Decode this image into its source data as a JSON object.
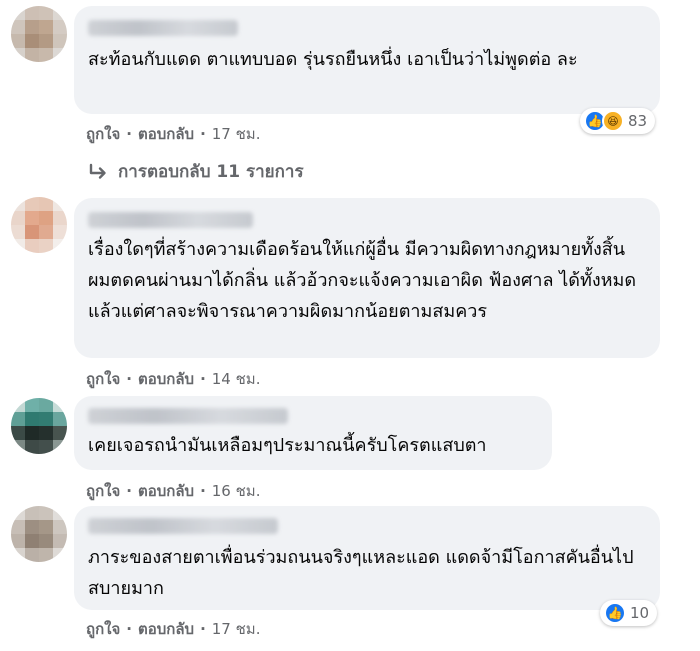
{
  "comments": [
    {
      "text": "สะท้อนกับแดด ตาแทบบอด รุ่นรถยืนหนึ่ง เอาเป็นว่าไม่พูดต่อ ละ",
      "like_label": "ถูกใจ",
      "reply_label": "ตอบกลับ",
      "time": "17 ชม.",
      "reaction_count": "83",
      "reactions": [
        "like-icon",
        "haha-icon"
      ]
    },
    {
      "text": "เรื่องใดๆที่สร้างความเดือดร้อนให้แก่ผู้อื่น มีความผิดทางกฎหมายทั้งสิ้น ผมตดคนผ่านมาได้กลิ่น แล้วอ้วกจะแจ้งความเอาผิด ฟ้องศาล ได้ทั้งหมด แล้วแต่ศาลจะพิจารณาความผิดมากน้อยตามสมควร",
      "like_label": "ถูกใจ",
      "reply_label": "ตอบกลับ",
      "time": "14 ชม."
    },
    {
      "text": "เคยเจอรถนำมันเหลือมๆประมาณนี้ครับโครตแสบตา",
      "like_label": "ถูกใจ",
      "reply_label": "ตอบกลับ",
      "time": "16 ชม."
    },
    {
      "text": "ภาระของสายตาเพื่อนร่วมถนนจริงๆแหละแอด แดดจ้ามีโอกาสคันอื่นไปสบายมาก",
      "like_label": "ถูกใจ",
      "reply_label": "ตอบกลับ",
      "time": "17 ชม.",
      "reaction_count": "10",
      "reactions": [
        "like-icon"
      ]
    }
  ],
  "replies_link": "การตอบกลับ 11 รายการ",
  "separator": "·",
  "colors": {
    "bubble": "#f0f2f5",
    "meta": "#65676b",
    "like": "#1877f2",
    "haha": "#f7b125"
  }
}
